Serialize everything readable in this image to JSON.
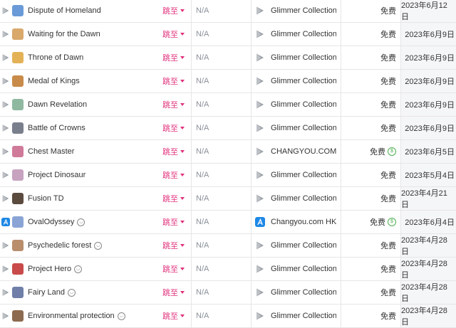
{
  "colors": {
    "accent": "#e0317d",
    "grid": "#e6e6e6",
    "date_bg": "#f5f6f8",
    "free_badge": "#4caf50"
  },
  "rows": [
    {
      "store": "play-store",
      "icon_color": "#6a9bd8",
      "name": "Dispute of Homeland",
      "emoji": false,
      "jump": "跳至",
      "rank": "N/A",
      "publisher_icon": "play-store",
      "publisher": "Glimmer Collection Gc",
      "price": "免费",
      "dollar": false,
      "date": "2023年6月12日"
    },
    {
      "store": "play-store",
      "icon_color": "#d9a86b",
      "name": "Waiting for the Dawn",
      "emoji": false,
      "jump": "跳至",
      "rank": "N/A",
      "publisher_icon": "play-store",
      "publisher": "Glimmer Collection Gc",
      "price": "免费",
      "dollar": false,
      "date": "2023年6月9日"
    },
    {
      "store": "play-store",
      "icon_color": "#e3b257",
      "name": "Throne of Dawn",
      "emoji": false,
      "jump": "跳至",
      "rank": "N/A",
      "publisher_icon": "play-store",
      "publisher": "Glimmer Collection Gc",
      "price": "免费",
      "dollar": false,
      "date": "2023年6月9日"
    },
    {
      "store": "play-store",
      "icon_color": "#c98b4a",
      "name": "Medal of Kings",
      "emoji": false,
      "jump": "跳至",
      "rank": "N/A",
      "publisher_icon": "play-store",
      "publisher": "Glimmer Collection Gc",
      "price": "免费",
      "dollar": false,
      "date": "2023年6月9日"
    },
    {
      "store": "play-store",
      "icon_color": "#8fb8a0",
      "name": "Dawn Revelation",
      "emoji": false,
      "jump": "跳至",
      "rank": "N/A",
      "publisher_icon": "play-store",
      "publisher": "Glimmer Collection Gc",
      "price": "免费",
      "dollar": false,
      "date": "2023年6月9日"
    },
    {
      "store": "play-store",
      "icon_color": "#7a7f8c",
      "name": "Battle of Crowns",
      "emoji": false,
      "jump": "跳至",
      "rank": "N/A",
      "publisher_icon": "play-store",
      "publisher": "Glimmer Collection Gc",
      "price": "免费",
      "dollar": false,
      "date": "2023年6月9日"
    },
    {
      "store": "play-store",
      "icon_color": "#d07a9a",
      "name": "Chest Master",
      "emoji": false,
      "jump": "跳至",
      "rank": "N/A",
      "publisher_icon": "play-store",
      "publisher": "CHANGYOU.COM",
      "price": "免费",
      "dollar": true,
      "date": "2023年6月5日"
    },
    {
      "store": "play-store",
      "icon_color": "#c7a3c0",
      "name": "Project Dinosaur",
      "emoji": false,
      "jump": "跳至",
      "rank": "N/A",
      "publisher_icon": "play-store",
      "publisher": "Glimmer Collection Gc",
      "price": "免费",
      "dollar": false,
      "date": "2023年5月4日"
    },
    {
      "store": "play-store",
      "icon_color": "#5b4a3e",
      "name": "Fusion TD",
      "emoji": false,
      "jump": "跳至",
      "rank": "N/A",
      "publisher_icon": "play-store",
      "publisher": "Glimmer Collection Gc",
      "price": "免费",
      "dollar": false,
      "date": "2023年4月21日"
    },
    {
      "store": "app-store",
      "icon_color": "#8aa4d6",
      "name": "OvalOdyssey",
      "emoji": true,
      "jump": "跳至",
      "rank": "N/A",
      "publisher_icon": "app-store",
      "publisher": "Changyou.com HK Lin",
      "price": "免费",
      "dollar": true,
      "date": "2023年6月4日"
    },
    {
      "store": "play-store",
      "icon_color": "#b98e6d",
      "name": "Psychedelic forest",
      "emoji": true,
      "jump": "跳至",
      "rank": "N/A",
      "publisher_icon": "play-store",
      "publisher": "Glimmer Collection Gc",
      "price": "免费",
      "dollar": false,
      "date": "2023年4月28日"
    },
    {
      "store": "play-store",
      "icon_color": "#c94a4a",
      "name": "Project Hero",
      "emoji": true,
      "jump": "跳至",
      "rank": "N/A",
      "publisher_icon": "play-store",
      "publisher": "Glimmer Collection Gc",
      "price": "免费",
      "dollar": false,
      "date": "2023年4月28日"
    },
    {
      "store": "play-store",
      "icon_color": "#6f7fa8",
      "name": "Fairy Land",
      "emoji": true,
      "jump": "跳至",
      "rank": "N/A",
      "publisher_icon": "play-store",
      "publisher": "Glimmer Collection Gc",
      "price": "免费",
      "dollar": false,
      "date": "2023年4月28日"
    },
    {
      "store": "play-store",
      "icon_color": "#8c6a4f",
      "name": "Environmental protection",
      "emoji": true,
      "jump": "跳至",
      "rank": "N/A",
      "publisher_icon": "play-store",
      "publisher": "Glimmer Collection Gc",
      "price": "免费",
      "dollar": false,
      "date": "2023年4月28日"
    }
  ]
}
